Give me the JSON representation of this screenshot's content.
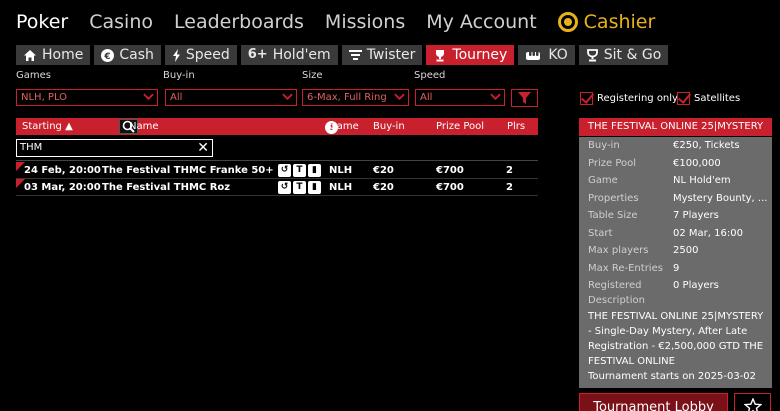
{
  "topnav": {
    "poker": "Poker",
    "casino": "Casino",
    "leaderboards": "Leaderboards",
    "missions": "Missions",
    "account": "My Account",
    "cashier": "Cashier"
  },
  "tabs": [
    {
      "label": "Home",
      "icon": "home-icon"
    },
    {
      "label": "Cash",
      "icon": "euro-icon"
    },
    {
      "label": "Speed",
      "icon": "bolt-icon"
    },
    {
      "label": "Hold'em",
      "icon": "six-plus-icon",
      "glyph": "6+"
    },
    {
      "label": "Twister",
      "icon": "twister-icon"
    },
    {
      "label": "Tourney",
      "icon": "trophy-icon"
    },
    {
      "label": "KO",
      "icon": "fist-icon"
    },
    {
      "label": "Sit & Go",
      "icon": "cup-icon"
    }
  ],
  "filters": {
    "games_label": "Games",
    "games_value": "NLH, PLO",
    "buyin_label": "Buy-in",
    "buyin_value": "All",
    "size_label": "Size",
    "size_value": "6-Max, Full Ring",
    "speed_label": "Speed",
    "speed_value": "All",
    "registering_only": "Registering only",
    "satellites": "Satellites"
  },
  "table": {
    "headers": {
      "starting": "Starting ▲",
      "name": "Name",
      "game": "Game",
      "buyin": "Buy-in",
      "prize": "Prize Pool",
      "plrs": "Plrs"
    },
    "search_value": "THM",
    "rows": [
      {
        "start": "24 Feb, 20:00",
        "name": "The Festival THMC Franke 50+",
        "game": "NLH",
        "buyin": "€20",
        "prize": "€700",
        "plrs": "2"
      },
      {
        "start": "03 Mar, 20:00",
        "name": "The Festival THMC Roz",
        "game": "NLH",
        "buyin": "€20",
        "prize": "€700",
        "plrs": "2"
      }
    ]
  },
  "panel": {
    "title": "THE FESTIVAL ONLINE 25|MYSTERY",
    "rows": [
      {
        "key": "Buy-in",
        "value": "€250, Tickets"
      },
      {
        "key": "Prize Pool",
        "value": "€100,000"
      },
      {
        "key": "Game",
        "value": "NL Hold'em"
      },
      {
        "key": "Properties",
        "value": "Mystery Bounty, ..."
      },
      {
        "key": "Table Size",
        "value": "7 Players"
      },
      {
        "key": "Start",
        "value": "02 Mar, 16:00"
      },
      {
        "key": "Max players",
        "value": "2500"
      },
      {
        "key": "Max Re-Entries",
        "value": "9"
      },
      {
        "key": "Registered",
        "value": "0 Players"
      }
    ],
    "description_label": "Description",
    "description": "THE FESTIVAL ONLINE 25|MYSTERY - Single-Day Mystery, After Late Registration - €2,500,000 GTD THE FESTIVAL ONLINE",
    "description_2": "Tournament starts on 2025-03-02",
    "lobby_button": "Tournament Lobby"
  },
  "colors": {
    "accent": "#c8202c",
    "cashier": "#e8b21c",
    "panel_bg": "#6b6b6b",
    "tab_bg": "#3a3a3a"
  }
}
